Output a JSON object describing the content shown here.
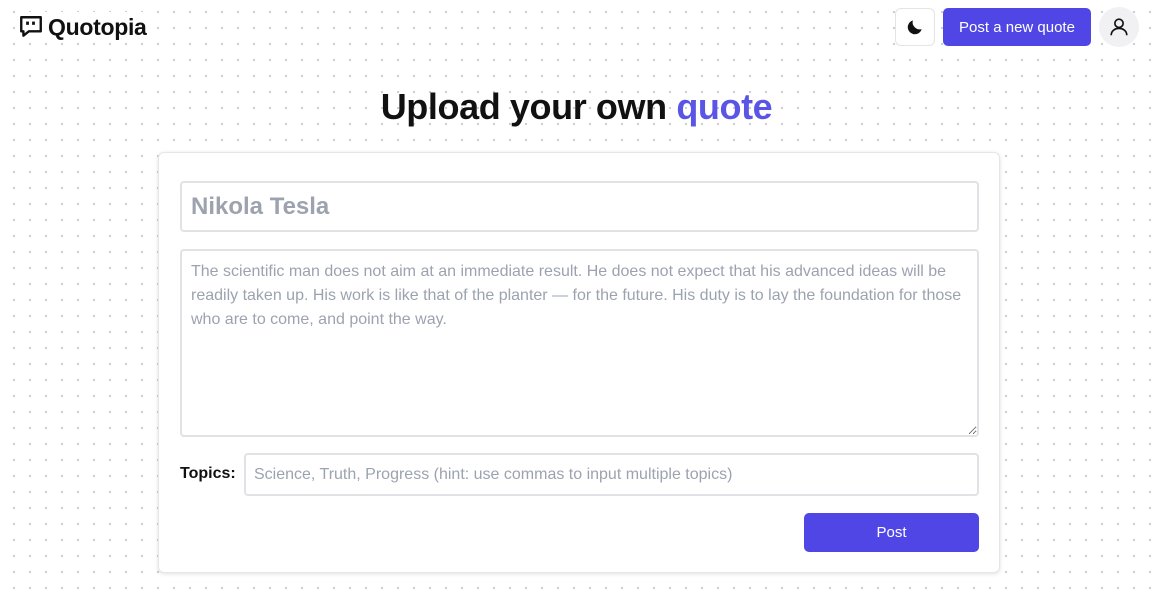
{
  "app": {
    "name": "Quotopia"
  },
  "header": {
    "theme_toggle_icon": "moon-icon",
    "post_new_label": "Post a new quote",
    "avatar_icon": "user-icon"
  },
  "page": {
    "title_prefix": "Upload your own",
    "title_accent": "quote"
  },
  "form": {
    "author_placeholder": "Nikola Tesla",
    "quote_placeholder": "The scientific man does not aim at an immediate result. He does not expect that his advanced ideas will be readily taken up. His work is like that of the planter — for the future. His duty is to lay the foundation for those who are to come, and point the way.",
    "topics_label": "Topics:",
    "topics_placeholder": "Science, Truth, Progress (hint: use commas to input multiple topics)",
    "submit_label": "Post"
  },
  "colors": {
    "accent": "#4f46e5",
    "title_accent": "#5b55e6",
    "placeholder": "#9ca3af"
  }
}
